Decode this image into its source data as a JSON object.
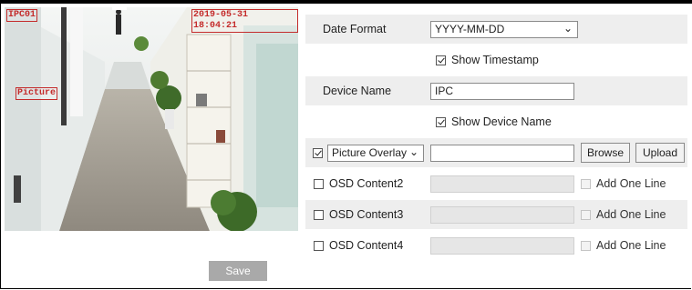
{
  "preview": {
    "osd_device_name": "IPC01",
    "osd_timestamp": "2019-05-31 18:04:21",
    "osd_picture_label": "Picture"
  },
  "settings": {
    "date_format": {
      "label": "Date Format",
      "value": "YYYY-MM-DD"
    },
    "show_timestamp": {
      "label": "Show Timestamp",
      "checked": true
    },
    "device_name": {
      "label": "Device Name",
      "value": "IPC"
    },
    "show_device_name": {
      "label": "Show Device Name",
      "checked": true
    },
    "picture_overlay": {
      "checked": true,
      "select_value": "Picture Overlay",
      "file_value": "",
      "browse_label": "Browse",
      "upload_label": "Upload"
    },
    "osd_rows": [
      {
        "label": "OSD Content2",
        "value": "",
        "add_line_label": "Add One Line"
      },
      {
        "label": "OSD Content3",
        "value": "",
        "add_line_label": "Add One Line"
      },
      {
        "label": "OSD Content4",
        "value": "",
        "add_line_label": "Add One Line"
      }
    ],
    "save_label": "Save"
  }
}
